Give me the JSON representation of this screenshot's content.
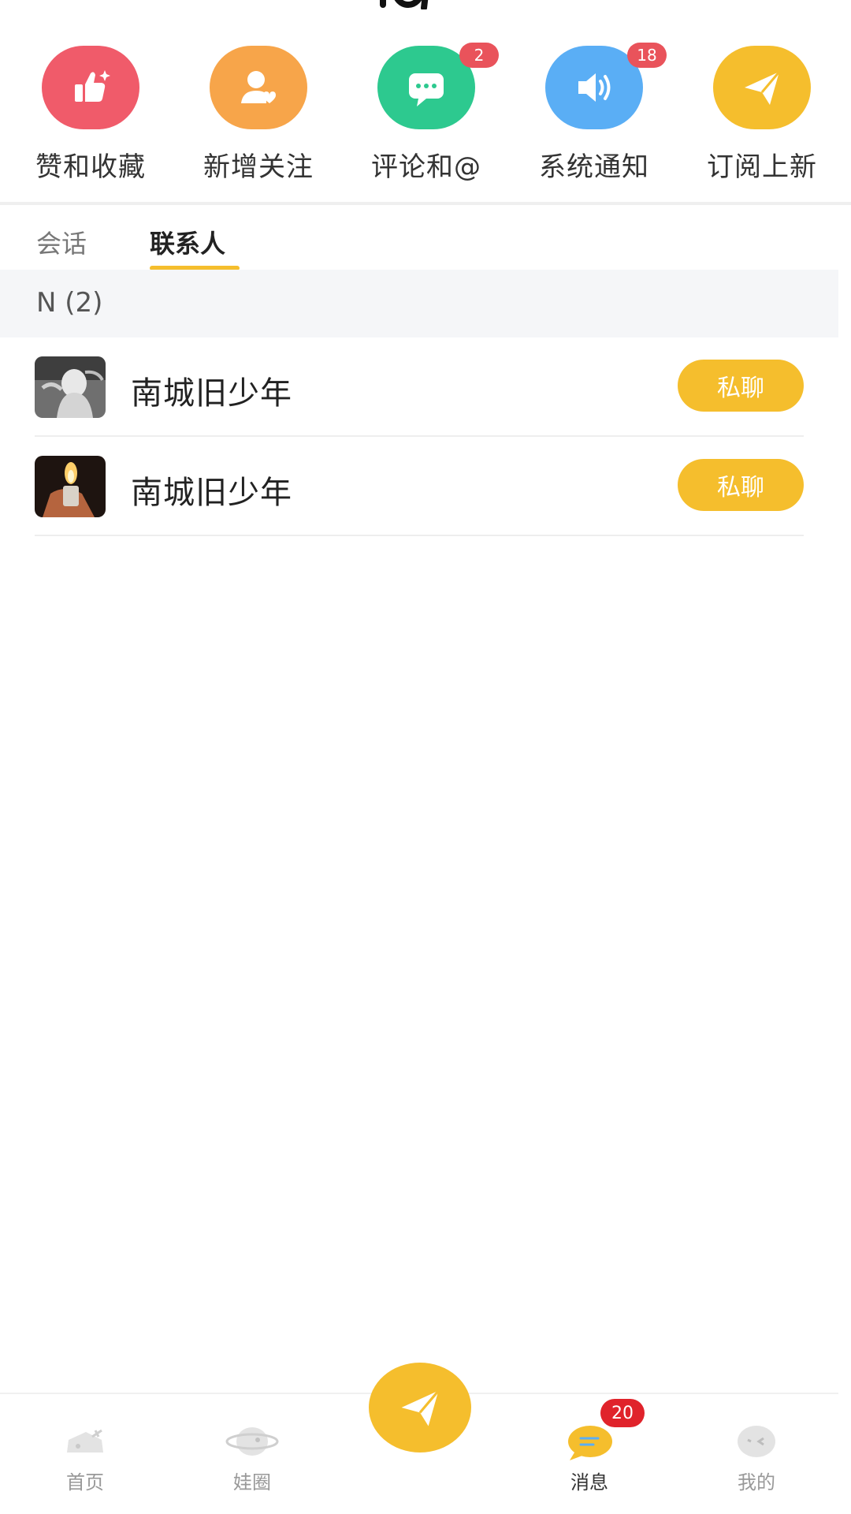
{
  "categories": [
    {
      "label": "赞和收藏",
      "icon": "thumbs-up-icon",
      "color": "#f05b6a"
    },
    {
      "label": "新增关注",
      "icon": "user-heart-icon",
      "color": "#f7a54a"
    },
    {
      "label": "评论和@",
      "icon": "chat-bubble-icon",
      "color": "#2dc98f",
      "badge": "2"
    },
    {
      "label": "系统通知",
      "icon": "speaker-icon",
      "color": "#5aaef5",
      "badge": "18"
    },
    {
      "label": "订阅上新",
      "icon": "paper-plane-icon",
      "color": "#f5be2d"
    }
  ],
  "tabs": [
    {
      "label": "会话",
      "active": false
    },
    {
      "label": "联系人",
      "active": true
    }
  ],
  "section": {
    "header": "N (2)"
  },
  "contacts": [
    {
      "name": "南城旧少年",
      "button": "私聊",
      "avatar": "grayscale-figure-avatar"
    },
    {
      "name": "南城旧少年",
      "button": "私聊",
      "avatar": "lighter-flame-avatar"
    }
  ],
  "bottom_nav": [
    {
      "label": "首页",
      "icon": "home-doll-icon",
      "active": false
    },
    {
      "label": "娃圈",
      "icon": "planet-icon",
      "active": false
    },
    {
      "label": "",
      "icon": "paper-plane-icon",
      "active": false
    },
    {
      "label": "消息",
      "icon": "message-icon",
      "active": true,
      "badge": "20"
    },
    {
      "label": "我的",
      "icon": "profile-face-icon",
      "active": false
    }
  ],
  "colors": {
    "accent": "#f5be2d",
    "badge": "#e9535b",
    "nav_badge": "#e0232b"
  }
}
